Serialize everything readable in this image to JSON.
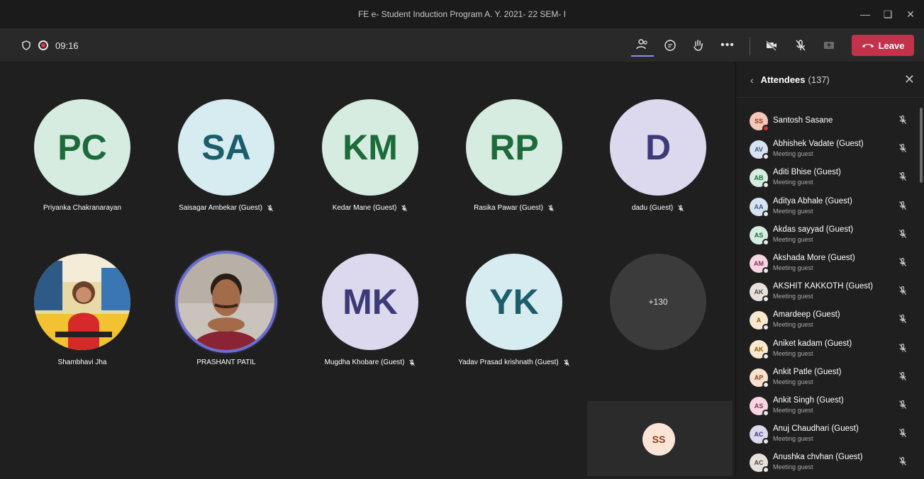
{
  "window": {
    "title": "FE e- Student Induction Program A. Y. 2021- 22 SEM- I"
  },
  "toolbar": {
    "timer": "09:16",
    "leave_label": "Leave"
  },
  "tiles": [
    {
      "initials": "PC",
      "name": "Priyanka Chakranarayan",
      "muted": false,
      "bg": "#d6ece0",
      "fg": "#1d6a3a"
    },
    {
      "initials": "SA",
      "name": "Saisagar Ambekar (Guest)",
      "muted": true,
      "bg": "#d7ecf0",
      "fg": "#1b5d6b"
    },
    {
      "initials": "KM",
      "name": "Kedar Mane (Guest)",
      "muted": true,
      "bg": "#d6ece0",
      "fg": "#1d6a3a"
    },
    {
      "initials": "RP",
      "name": "Rasika Pawar (Guest)",
      "muted": true,
      "bg": "#d6ece0",
      "fg": "#1d6a3a"
    },
    {
      "initials": "D",
      "name": "dadu (Guest)",
      "muted": true,
      "bg": "#dcd8ee",
      "fg": "#3d3a78"
    },
    {
      "initials": "",
      "name": "Shambhavi Jha",
      "muted": false,
      "photo": "shambhavi"
    },
    {
      "initials": "",
      "name": "PRASHANT PATIL",
      "muted": false,
      "photo": "prashant"
    },
    {
      "initials": "MK",
      "name": "Mugdha Khobare (Guest)",
      "muted": true,
      "bg": "#dcd8ee",
      "fg": "#3d3a78"
    },
    {
      "initials": "YK",
      "name": "Yadav Prasad krishnath (Guest)",
      "muted": true,
      "bg": "#d7ecf0",
      "fg": "#1b5d6b"
    },
    {
      "initials": "+130",
      "name": "",
      "muted": false,
      "more": true
    }
  ],
  "self_view": {
    "initials": "SS"
  },
  "panel": {
    "title": "Attendees",
    "count": "(137)",
    "attendees": [
      {
        "initials": "SS",
        "name": "Santosh Sasane",
        "sub": "",
        "bg": "#f3c7b9",
        "fg": "#8f3c1b",
        "status": "red"
      },
      {
        "initials": "AV",
        "name": "Abhishek Vadate (Guest)",
        "sub": "Meeting guest",
        "bg": "#d7e3f2",
        "fg": "#3b5a86",
        "status": "white"
      },
      {
        "initials": "AB",
        "name": "Aditi Bhise (Guest)",
        "sub": "Meeting guest",
        "bg": "#d6ece0",
        "fg": "#1d6a3a",
        "status": "white"
      },
      {
        "initials": "AA",
        "name": "Aditya Abhale (Guest)",
        "sub": "Meeting guest",
        "bg": "#d7e3f2",
        "fg": "#3b5a86",
        "status": "white"
      },
      {
        "initials": "AS",
        "name": "Akdas sayyad (Guest)",
        "sub": "Meeting guest",
        "bg": "#d6ece0",
        "fg": "#1d6a3a",
        "status": "white"
      },
      {
        "initials": "AM",
        "name": "Akshada More (Guest)",
        "sub": "Meeting guest",
        "bg": "#f6d6e3",
        "fg": "#8b2e5c",
        "status": "white"
      },
      {
        "initials": "AK",
        "name": "AKSHIT KAKKOTH (Guest)",
        "sub": "Meeting guest",
        "bg": "#e6e1dc",
        "fg": "#5c4a3c",
        "status": "white"
      },
      {
        "initials": "A",
        "name": "Amardeep (Guest)",
        "sub": "Meeting guest",
        "bg": "#fbe9cf",
        "fg": "#8a5a10",
        "status": "white"
      },
      {
        "initials": "AK",
        "name": "Aniket kadam (Guest)",
        "sub": "Meeting guest",
        "bg": "#fbe9cf",
        "fg": "#8a5a10",
        "status": "white"
      },
      {
        "initials": "AP",
        "name": "Ankit Patle (Guest)",
        "sub": "Meeting guest",
        "bg": "#fbe1cf",
        "fg": "#8a4310",
        "status": "white"
      },
      {
        "initials": "AS",
        "name": "Ankit Singh (Guest)",
        "sub": "Meeting guest",
        "bg": "#f6d6e3",
        "fg": "#8b2e5c",
        "status": "white"
      },
      {
        "initials": "AC",
        "name": "Anuj Chaudhari (Guest)",
        "sub": "Meeting guest",
        "bg": "#dcd8ee",
        "fg": "#3d3a78",
        "status": "white"
      },
      {
        "initials": "AC",
        "name": "Anushka chvhan (Guest)",
        "sub": "Meeting guest",
        "bg": "#e6e1dc",
        "fg": "#5c4a3c",
        "status": "white"
      }
    ]
  }
}
